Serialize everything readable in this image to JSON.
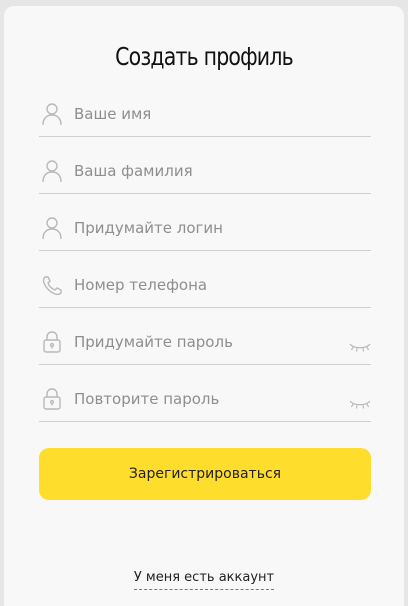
{
  "page": {
    "title": "Создать профиль"
  },
  "form": {
    "fields": [
      {
        "name": "first_name",
        "placeholder": "Ваше имя",
        "icon": "user-icon"
      },
      {
        "name": "last_name",
        "placeholder": "Ваша фамилия",
        "icon": "user-icon"
      },
      {
        "name": "login",
        "placeholder": "Придумайте логин",
        "icon": "user-icon"
      },
      {
        "name": "phone",
        "placeholder": "Номер телефона",
        "icon": "phone-icon"
      },
      {
        "name": "password",
        "placeholder": "Придумайте пароль",
        "icon": "lock-icon",
        "toggle_icon": "eye-closed-icon"
      },
      {
        "name": "password_repeat",
        "placeholder": "Повторите пароль",
        "icon": "lock-icon",
        "toggle_icon": "eye-closed-icon"
      }
    ],
    "submit_label": "Зарегистрироваться",
    "have_account_label": "У меня есть аккаунт"
  },
  "colors": {
    "accent": "#ffdd2d",
    "background": "#f8f8f8",
    "placeholder": "#8e8e8e"
  }
}
